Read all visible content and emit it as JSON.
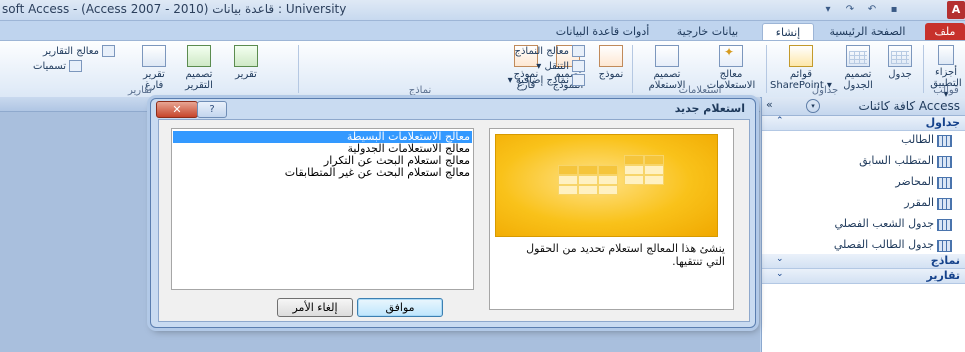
{
  "window": {
    "title": "soft Access - (Access 2007 - 2010) قاعدة بيانات : University"
  },
  "qat": {
    "save": "▪",
    "undo": "↶",
    "redo": "↷",
    "more": "▾"
  },
  "app_logo": "A",
  "tabs": {
    "file": "ملف",
    "home": "الصفحة الرئيسية",
    "create": "إنشاء",
    "external": "بيانات خارجية",
    "dbtools": "أدوات قاعدة البيانات"
  },
  "ribbon": {
    "templates": {
      "app_parts": "أجزاء\nالتطبيق ▾",
      "group": "قوالب"
    },
    "tables": {
      "table": "جدول",
      "table_design": "تصميم\nالجدول",
      "sp_lists": "قوائم\nSharePoint ▾",
      "group": "جداول"
    },
    "queries": {
      "wizard": "معالج\nالاستعلامات",
      "design": "تصميم\nالاستعلام",
      "group": "استعلامات"
    },
    "forms": {
      "form": "نموذج",
      "form_design": "تصميم\nالنموذج",
      "blank_form": "نموذج\nفارغ",
      "form_wizard": "معالج النماذج",
      "navigation": "التنقل ▾",
      "more_forms": "نماذج إضافية ▾",
      "group": "نماذج"
    },
    "reports": {
      "report": "تقرير",
      "report_design": "تصميم\nالتقرير",
      "blank_report": "تقرير\nفارغ",
      "report_wizard": "معالج التقارير",
      "labels": "تسميات",
      "group": "تقارير"
    }
  },
  "nav": {
    "title": "كافة كائنات Access",
    "tables_header": "جداول",
    "tables": [
      "الطالب",
      "المتطلب السابق",
      "المحاضر",
      "المقرر",
      "جدول الشعب الفصلي",
      "جدول الطالب الفصلي"
    ],
    "forms_header": "نماذج",
    "reports_header": "تقارير",
    "collapse": "«",
    "dropdown": "▾",
    "expand": "⌃",
    "chev": "⌄"
  },
  "dialog": {
    "title": "استعلام جديد",
    "close": "✕",
    "help": "?",
    "options": [
      "معالج الاستعلامات البسيطة",
      "معالج الاستعلامات الجدولية",
      "معالج استعلام البحث عن التكرار",
      "معالج استعلام البحث عن غير المتطابقات"
    ],
    "selected_index": 0,
    "description": "ينشئ هذا المعالج استعلام تحديد من الحقول التي تنتقيها.",
    "ok": "موافق",
    "cancel": "إلغاء الأمر"
  }
}
